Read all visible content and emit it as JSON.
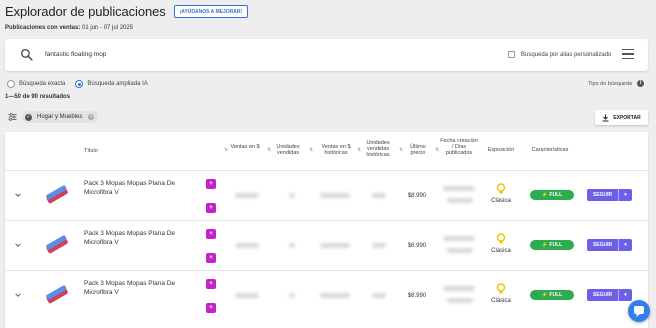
{
  "header": {
    "title": "Explorador de publicaciones",
    "help_button": "¡AYÚDANOS A MEJORAR!"
  },
  "period": {
    "label": "Publicaciones con ventas:",
    "value": "01 jun - 07 jul 2025"
  },
  "search": {
    "query": "fantastic floating mop",
    "alias_label": "Busqueda por alias personalizado",
    "alias_checked": false
  },
  "search_mode": {
    "options": [
      "Búsqueda exacta",
      "Búsqueda ampliada IA"
    ],
    "selected": "Búsqueda ampliada IA",
    "type_label": "Tipo de búsqueda"
  },
  "results_text": "1—50 de 90 resultados",
  "filter_chip": "Hogar y Muebles",
  "export_label": "EXPORTAR",
  "columns": {
    "titulo": "Título",
    "ventas": "Ventas en $",
    "unidades": "Unidades vendidas",
    "ventas_hist": "Ventas en $ históricas",
    "unidades_hist": "Unidades vendidas históricas",
    "ultimo_precio": "Último precio",
    "fecha": "Fecha creación / Días publicados",
    "exposicion": "Exposición",
    "caracteristicas": "Características"
  },
  "rows": [
    {
      "title": "Pack 3 Mopas Mopas Plana De Microfibra V",
      "price": "$8.990",
      "exposure": "Clásica",
      "shipping": "FULL",
      "action": "SEGUIR"
    },
    {
      "title": "Pack 3 Mopas Mopas Plana De Microfibra V",
      "price": "$6.990",
      "exposure": "Clásica",
      "shipping": "FULL",
      "action": "SEGUIR"
    },
    {
      "title": "Pack 3 Mopas Mopas Plana De Microfibra V",
      "price": "$8.990",
      "exposure": "Clásica",
      "shipping": "FULL",
      "action": "SEGUIR"
    }
  ],
  "colors": {
    "accent": "#3a6fd8",
    "full_badge": "#2eaa4f",
    "follow_button": "#6c5fe8",
    "badge_icon": "#c224c9",
    "exposure_bulb": "#f2c200"
  }
}
